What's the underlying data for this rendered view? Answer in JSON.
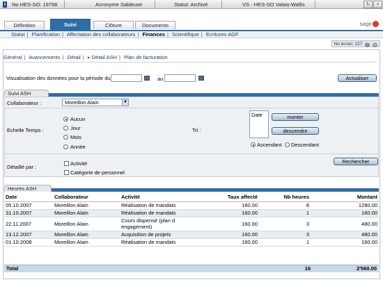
{
  "titlebar": {
    "dossier": "No HES-SO: 19768",
    "acronyme": "Acronyme Sableuse",
    "statut": "Statut: Archivé",
    "institution": "VS - HES-SO Valais-Wallis",
    "refresh_icon": "refresh-icon",
    "close_icon": "close-icon"
  },
  "main_tabs": [
    "Définition",
    "Suivi",
    "Clôture",
    "Documents"
  ],
  "main_tab_active": "Suivi",
  "logo": "sage",
  "subnav": [
    "Statut",
    "Planification",
    "Affectation des collaborateurs",
    "Finances",
    "Scientifique",
    "Ecritures AGF"
  ],
  "subnav_active": "Finances",
  "ecran": {
    "label": "No écran: 227",
    "help": "?",
    "print_icon": "printer-icon"
  },
  "subtabs": [
    "Général",
    "Avancements",
    "Détail",
    "Détail ASH",
    "Plan de facturation"
  ],
  "subtab_active": "Détail ASH",
  "period": {
    "label": "Visualisation des données pour la période du",
    "to_label": "au",
    "from_value": "",
    "to_value": ""
  },
  "buttons": {
    "actualiser": "Actualiser",
    "monter": "monter",
    "descendre": "descendre",
    "rechercher": "Rechercher"
  },
  "suivi": {
    "title": "Suivi ASH",
    "collaborateur_label": "Collaborateur :",
    "collaborateur_value": "Moreillon Alain",
    "echelle_label": "Echelle Temps :",
    "echelle_options": [
      "Aucun",
      "Jour",
      "Mois",
      "Année"
    ],
    "echelle_selected": "Aucun",
    "tri_label": "Tri :",
    "tri_list": [
      "Date"
    ],
    "ordre_options": [
      "Ascendant",
      "Descendant"
    ],
    "ordre_selected": "Ascendant",
    "detaille_label": "Détaillé par :",
    "detaille_options": [
      "Activité",
      "Catégorie de personnel"
    ]
  },
  "heures": {
    "title": "Heures ASH",
    "columns": [
      "Date",
      "Collaborateur",
      "Activité",
      "Taux affecté",
      "Nb heures",
      "Montant"
    ],
    "rows": [
      [
        "05.10.2007",
        "Moreillon Alain",
        "Réalisation de mandats",
        "160.00",
        "8",
        "1280.00"
      ],
      [
        "31.10.2007",
        "Moreillon Alain",
        "Réalisation de mandats",
        "160.00",
        "1",
        "160.00"
      ],
      [
        "22.11.2007",
        "Moreillon Alain",
        "Cours dispensé (plan d engagement)",
        "160.00",
        "3",
        "480.00"
      ],
      [
        "13.12.2007",
        "Moreillon Alain",
        "Acquisition de projets",
        "160.00",
        "3",
        "480.00"
      ],
      [
        "01.10.2008",
        "Moreillon Alain",
        "Réalisation de mandats",
        "160.00",
        "1",
        "160.00"
      ]
    ],
    "total_label": "Total",
    "total_heures": "16",
    "total_montant": "2'560.00"
  }
}
